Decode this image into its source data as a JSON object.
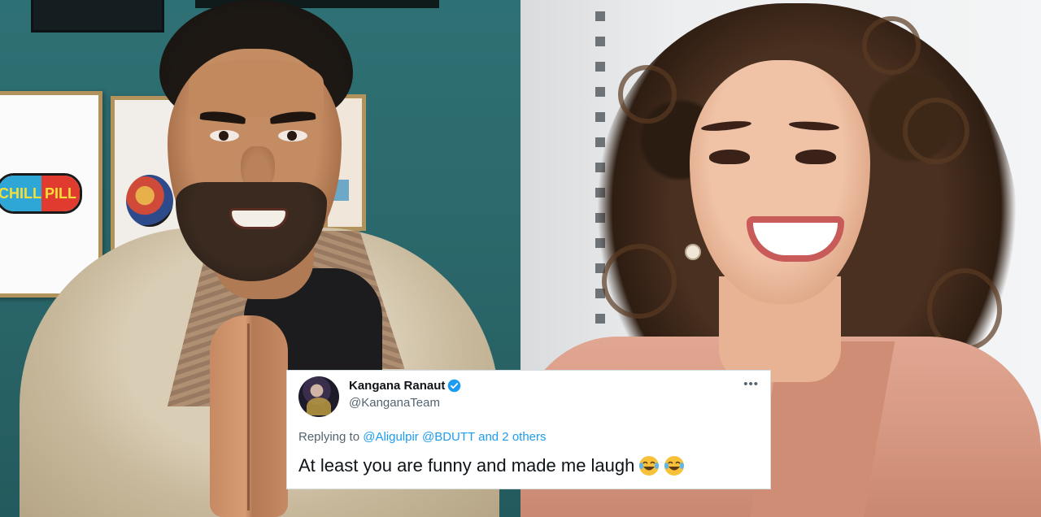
{
  "left_photo": {
    "poster_pill": {
      "left_text": "CHILL",
      "right_text": "PILL"
    }
  },
  "tweet": {
    "display_name": "Kangana Ranaut",
    "handle": "@KanganaTeam",
    "more_icon": "more-dots-icon",
    "verified_icon": "verified-badge-icon",
    "replying_prefix": "Replying to",
    "replying_mention_1": "@Aligulpir",
    "replying_mention_2": "@BDUTT",
    "replying_others": "and 2 others",
    "text": "At least you are funny and made me laugh",
    "emojis": [
      "tears-of-joy-emoji",
      "tears-of-joy-emoji"
    ],
    "colors": {
      "link": "#1d9bf0",
      "secondary": "#536471",
      "primary": "#0f1419"
    }
  }
}
